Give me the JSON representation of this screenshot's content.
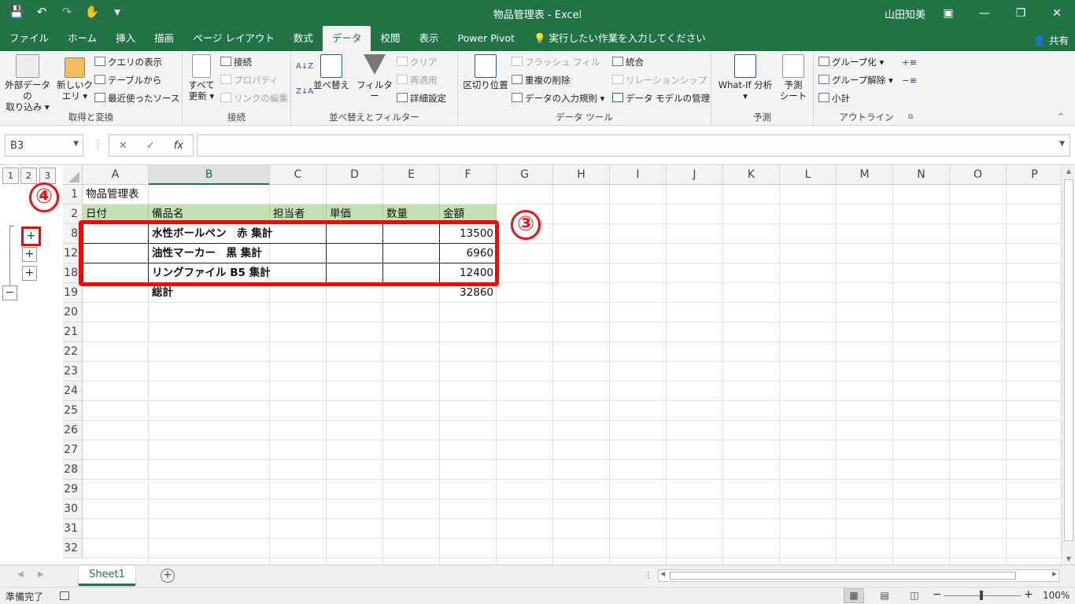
{
  "title_bar": {
    "title": "物品管理表 - Excel",
    "user": "山田知美"
  },
  "menu": {
    "tabs": [
      "ファイル",
      "ホーム",
      "挿入",
      "描画",
      "ページ レイアウト",
      "数式",
      "データ",
      "校閲",
      "表示",
      "Power Pivot",
      "実行したい作業を入力してください"
    ],
    "share": "共有"
  },
  "ribbon": {
    "get_transform": {
      "external_data": "外部データの",
      "external_data2": "取り込み",
      "new_query": "新しいク",
      "new_query2": "エリ",
      "show_queries": "クエリの表示",
      "from_table": "テーブルから",
      "recent_sources": "最近使ったソース",
      "label": "取得と変換"
    },
    "connections": {
      "refresh_all": "すべて",
      "refresh_all2": "更新",
      "connections": "接続",
      "properties": "プロパティ",
      "edit_links": "リンクの編集",
      "label": "接続"
    },
    "sort_filter": {
      "sort": "並べ替え",
      "filter": "フィルター",
      "clear": "クリア",
      "reapply": "再適用",
      "advanced": "詳細設定",
      "label": "並べ替えとフィルター"
    },
    "data_tools": {
      "text_to_columns": "区切り位置",
      "flash_fill": "フラッシュ フィル",
      "remove_duplicates": "重複の削除",
      "data_validation": "データの入力規則",
      "consolidate": "統合",
      "relationships": "リレーションシップ",
      "data_model": "データ モデルの管理",
      "label": "データ ツール"
    },
    "forecast": {
      "what_if": "What-If 分析",
      "forecast_sheet": "予測",
      "forecast_sheet2": "シート",
      "label": "予測"
    },
    "outline": {
      "group": "グループ化",
      "ungroup": "グループ解除",
      "subtotal": "小計",
      "label": "アウトライン"
    }
  },
  "formula_bar": {
    "name_box": "B3",
    "fx": "fx",
    "cancel": "✕",
    "enter": "✓",
    "formula": ""
  },
  "columns": [
    "A",
    "B",
    "C",
    "D",
    "E",
    "F",
    "G",
    "H",
    "I",
    "J",
    "K",
    "L",
    "M",
    "N",
    "O",
    "P"
  ],
  "selected_column": "B",
  "rows": [
    "1",
    "2",
    "8",
    "12",
    "18",
    "19",
    "20",
    "21",
    "22",
    "23",
    "24",
    "25",
    "26",
    "27",
    "28",
    "29",
    "30",
    "31",
    "32"
  ],
  "outline_levels": [
    "1",
    "2",
    "3"
  ],
  "outline_buttons": {
    "expand": "+",
    "collapse": "−"
  },
  "cells": {
    "a1": "物品管理表",
    "headers": [
      "日付",
      "備品名",
      "担当者",
      "単価",
      "数量",
      "金額"
    ],
    "r8_name": "水性ボールペン　赤 集計",
    "r8_amount": "13500",
    "r12_name": "油性マーカー　黒 集計",
    "r12_amount": "6960",
    "r18_name": "リングファイル B5 集計",
    "r18_amount": "12400",
    "r19_name": "総計",
    "r19_amount": "32860"
  },
  "annotations": {
    "badge3": "③",
    "badge4": "④"
  },
  "sheet_tabs": [
    "Sheet1"
  ],
  "status": {
    "ready": "準備完了",
    "zoom": "100%"
  },
  "colors": {
    "excel_green": "#217346",
    "header_fill": "#c6e0b4",
    "highlight": "#ff0000"
  }
}
